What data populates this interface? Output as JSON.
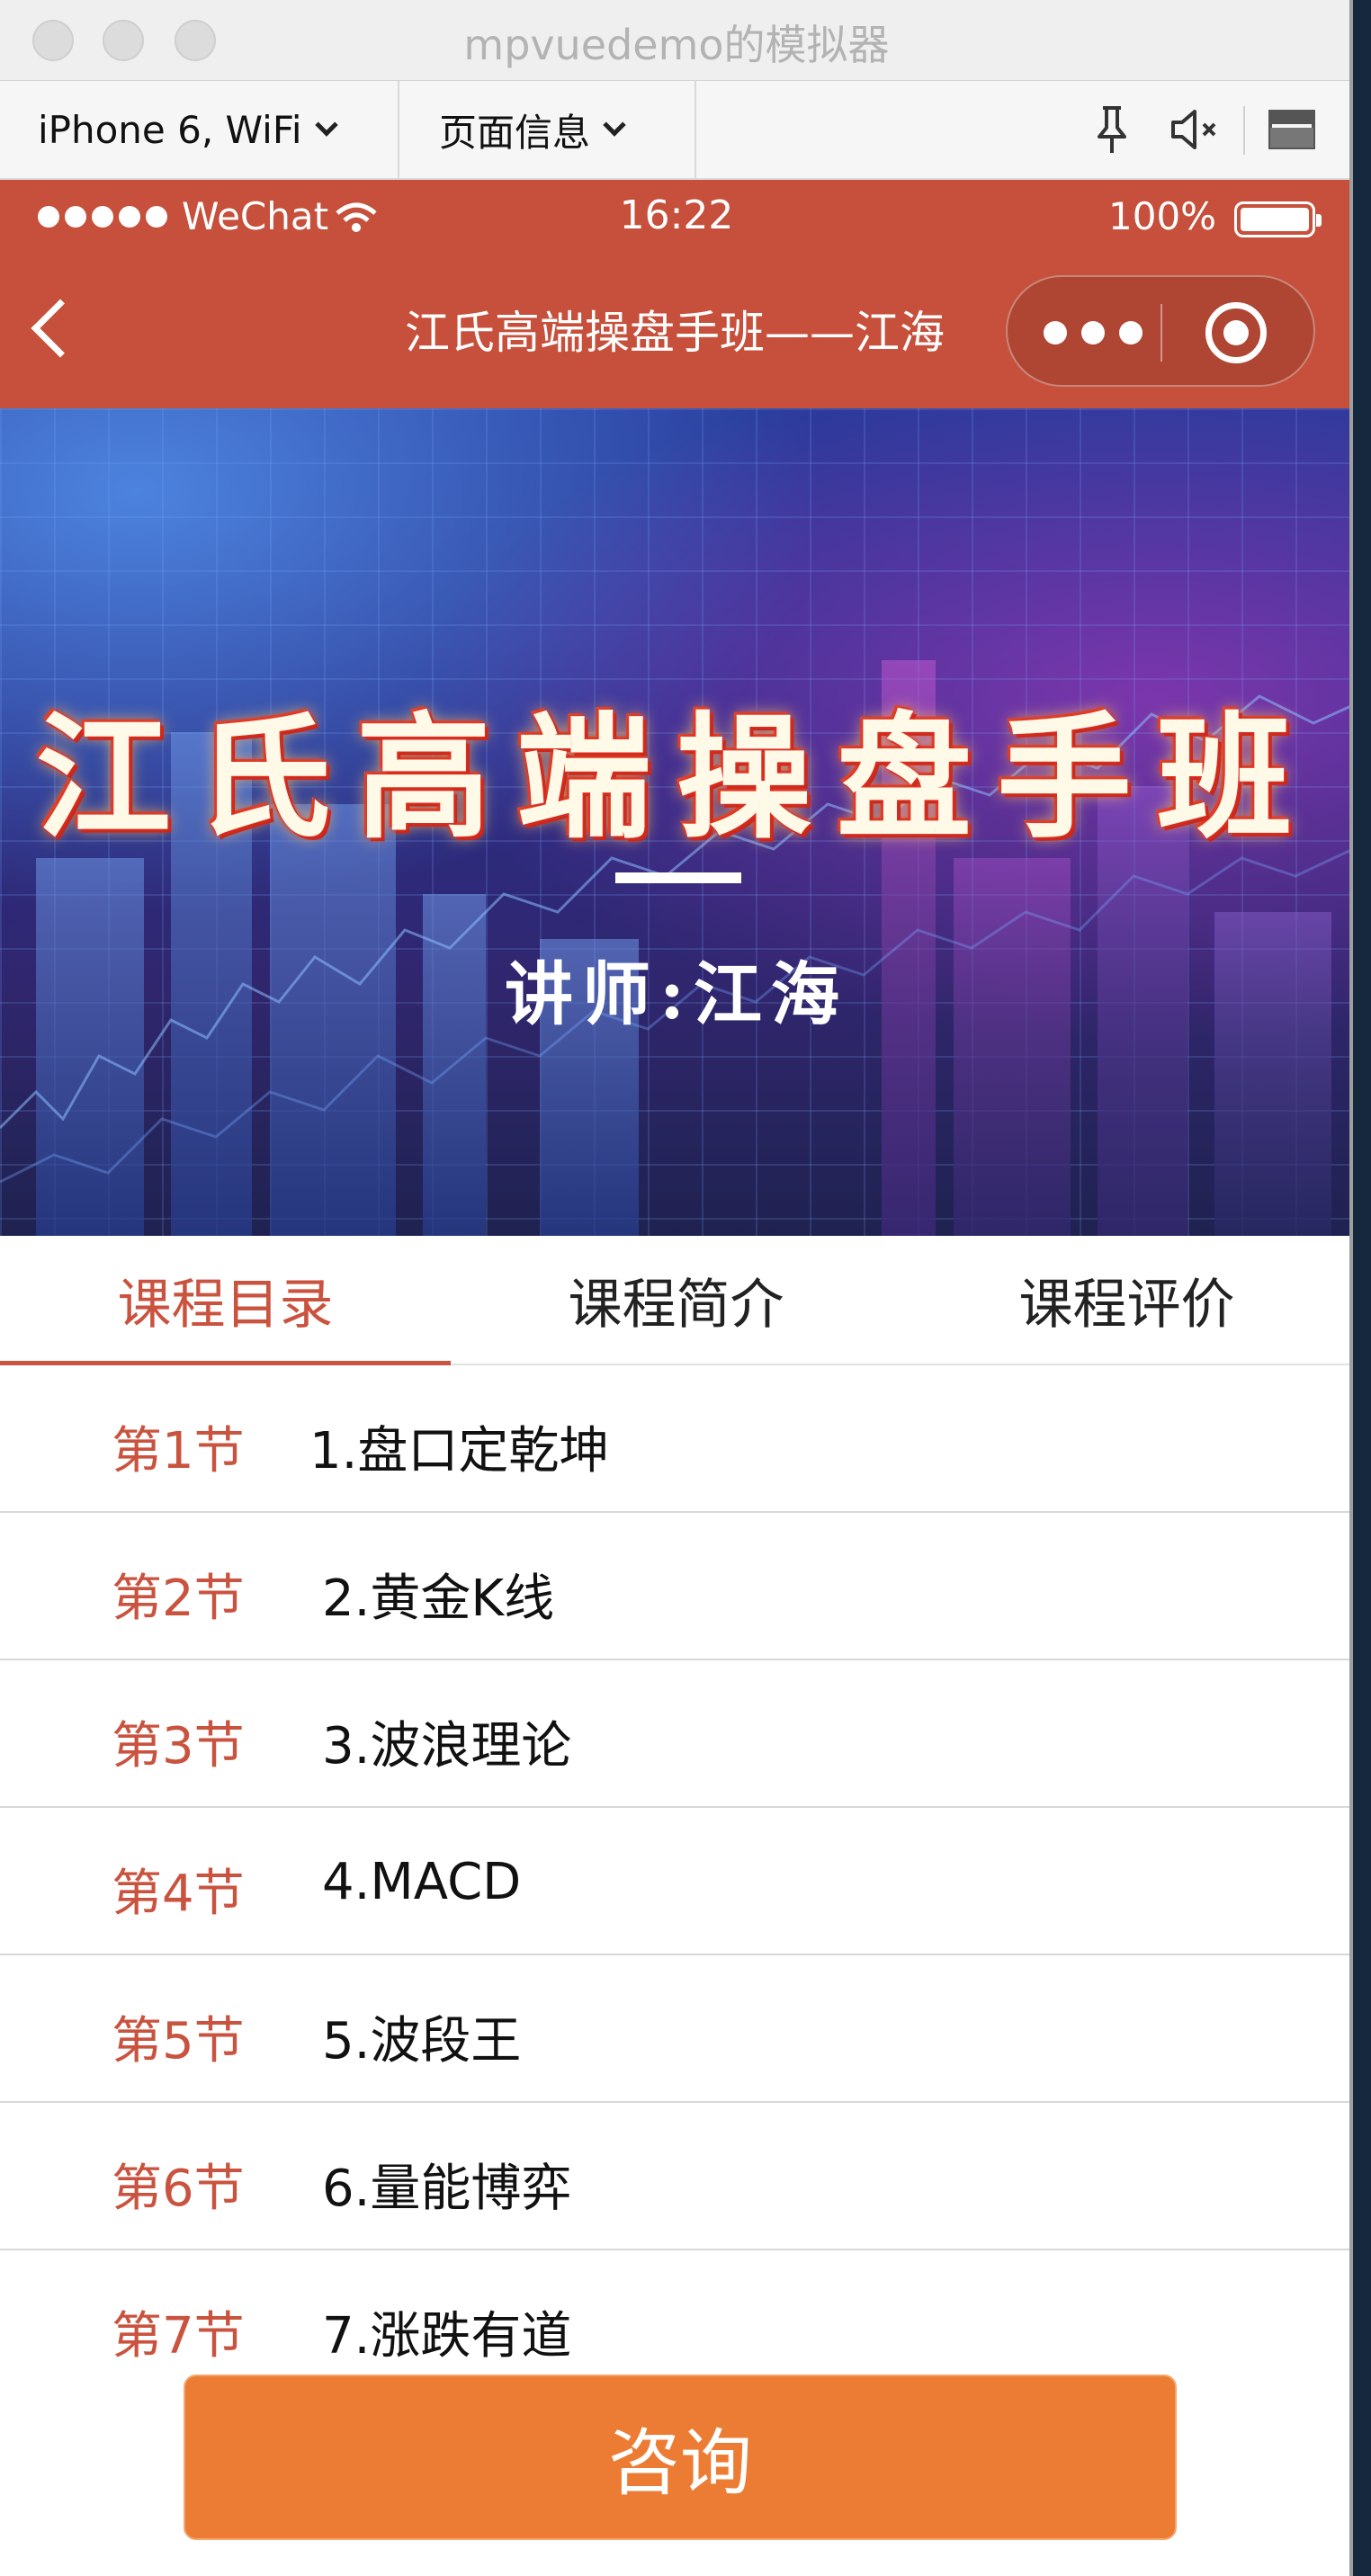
{
  "window": {
    "title": "mpvuedemo的模拟器"
  },
  "toolbar": {
    "device_label": "iPhone 6, WiFi",
    "page_info_label": "页面信息",
    "icons": [
      "pin-icon",
      "mute-icon",
      "window-icon"
    ]
  },
  "statusbar": {
    "carrier": "WeChat",
    "time": "16:22",
    "battery": "100%"
  },
  "navbar": {
    "title": "江氏高端操盘手班——江海"
  },
  "banner": {
    "title": "江氏高端操盘手班",
    "subtitle": "讲师:江海"
  },
  "tabs": [
    {
      "label": "课程目录",
      "active": true
    },
    {
      "label": "课程简介",
      "active": false
    },
    {
      "label": "课程评价",
      "active": false
    }
  ],
  "lessons": [
    {
      "section": "第1节",
      "name": "1.盘口定乾坤"
    },
    {
      "section": "第2节",
      "name": "2.黄金K线"
    },
    {
      "section": "第3节",
      "name": "3.波浪理论"
    },
    {
      "section": "第4节",
      "name": "4.MACD"
    },
    {
      "section": "第5节",
      "name": "5.波段王"
    },
    {
      "section": "第6节",
      "name": "6.量能博弈"
    },
    {
      "section": "第7节",
      "name": "7.涨跌有道"
    }
  ],
  "consult_button": {
    "label": "咨询"
  },
  "colors": {
    "brand_red": "#c6503b",
    "accent_orange": "#ec7c33",
    "active_tab": "#c9533f"
  }
}
